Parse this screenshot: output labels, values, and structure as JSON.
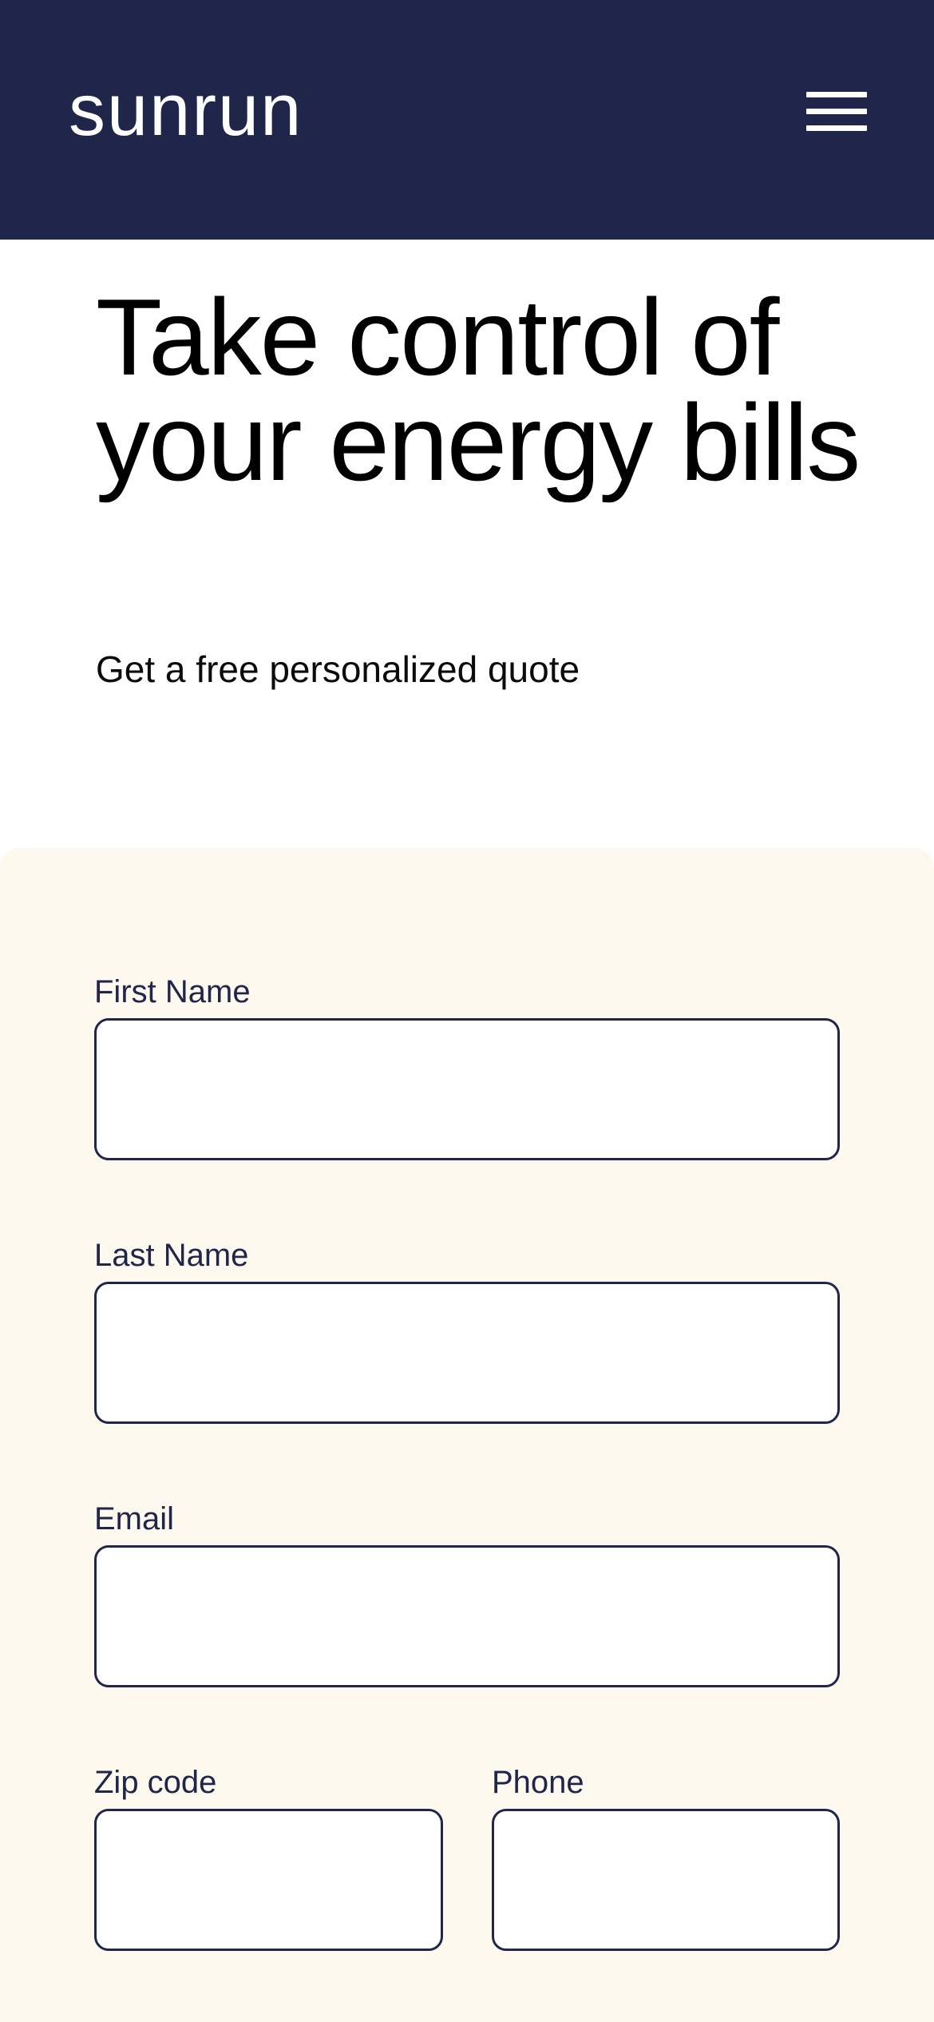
{
  "header": {
    "logo_text": "sunrun",
    "menu_icon": "hamburger-menu-icon",
    "background_color": "#20264a"
  },
  "hero": {
    "title": "Take control of your energy bills",
    "subtitle": "Get a free personalized quote"
  },
  "form": {
    "background_color": "#fdf9ef",
    "border_color": "#20264a",
    "fields": {
      "first_name": {
        "label": "First Name",
        "value": "",
        "placeholder": ""
      },
      "last_name": {
        "label": "Last Name",
        "value": "",
        "placeholder": ""
      },
      "email": {
        "label": "Email",
        "value": "",
        "placeholder": ""
      },
      "zip_code": {
        "label": "Zip code",
        "value": "",
        "placeholder": ""
      },
      "phone": {
        "label": "Phone",
        "value": "",
        "placeholder": ""
      }
    }
  }
}
